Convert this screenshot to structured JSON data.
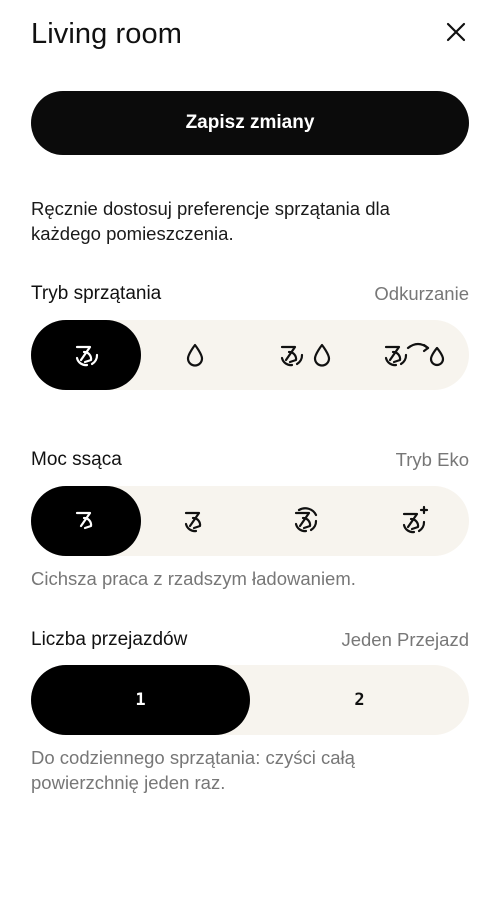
{
  "header": {
    "title": "Living room",
    "close_icon": "close-icon"
  },
  "save_button": {
    "label": "Zapisz zmiany"
  },
  "description": "Ręcznie dostosuj preferencje sprzątania dla każdego pomieszczenia.",
  "cleaning_mode": {
    "label": "Tryb sprzątania",
    "value": "Odkurzanie",
    "options": [
      {
        "icon": "fan-icon",
        "selected": true
      },
      {
        "icon": "water-drop-icon",
        "selected": false
      },
      {
        "icon": "fan-and-drop-icon",
        "selected": false
      },
      {
        "icon": "fan-then-drop-icon",
        "selected": false
      }
    ]
  },
  "suction_power": {
    "label": "Moc ssąca",
    "value": "Tryb Eko",
    "options": [
      {
        "icon": "fan-eco-icon",
        "selected": true
      },
      {
        "icon": "fan-standard-icon",
        "selected": false
      },
      {
        "icon": "fan-max-icon",
        "selected": false
      },
      {
        "icon": "fan-max-plus-icon",
        "selected": false
      }
    ],
    "hint": "Cichsza praca z rzadszym ładowaniem."
  },
  "passes": {
    "label": "Liczba przejazdów",
    "value": "Jeden Przejazd",
    "options": [
      {
        "label": "1",
        "selected": true
      },
      {
        "label": "2",
        "selected": false
      }
    ],
    "hint": "Do codziennego sprzątania: czyści całą powierzchnię jeden raz."
  },
  "colors": {
    "active": "#000000",
    "track": "#f7f4ee",
    "muted_text": "#777777"
  }
}
